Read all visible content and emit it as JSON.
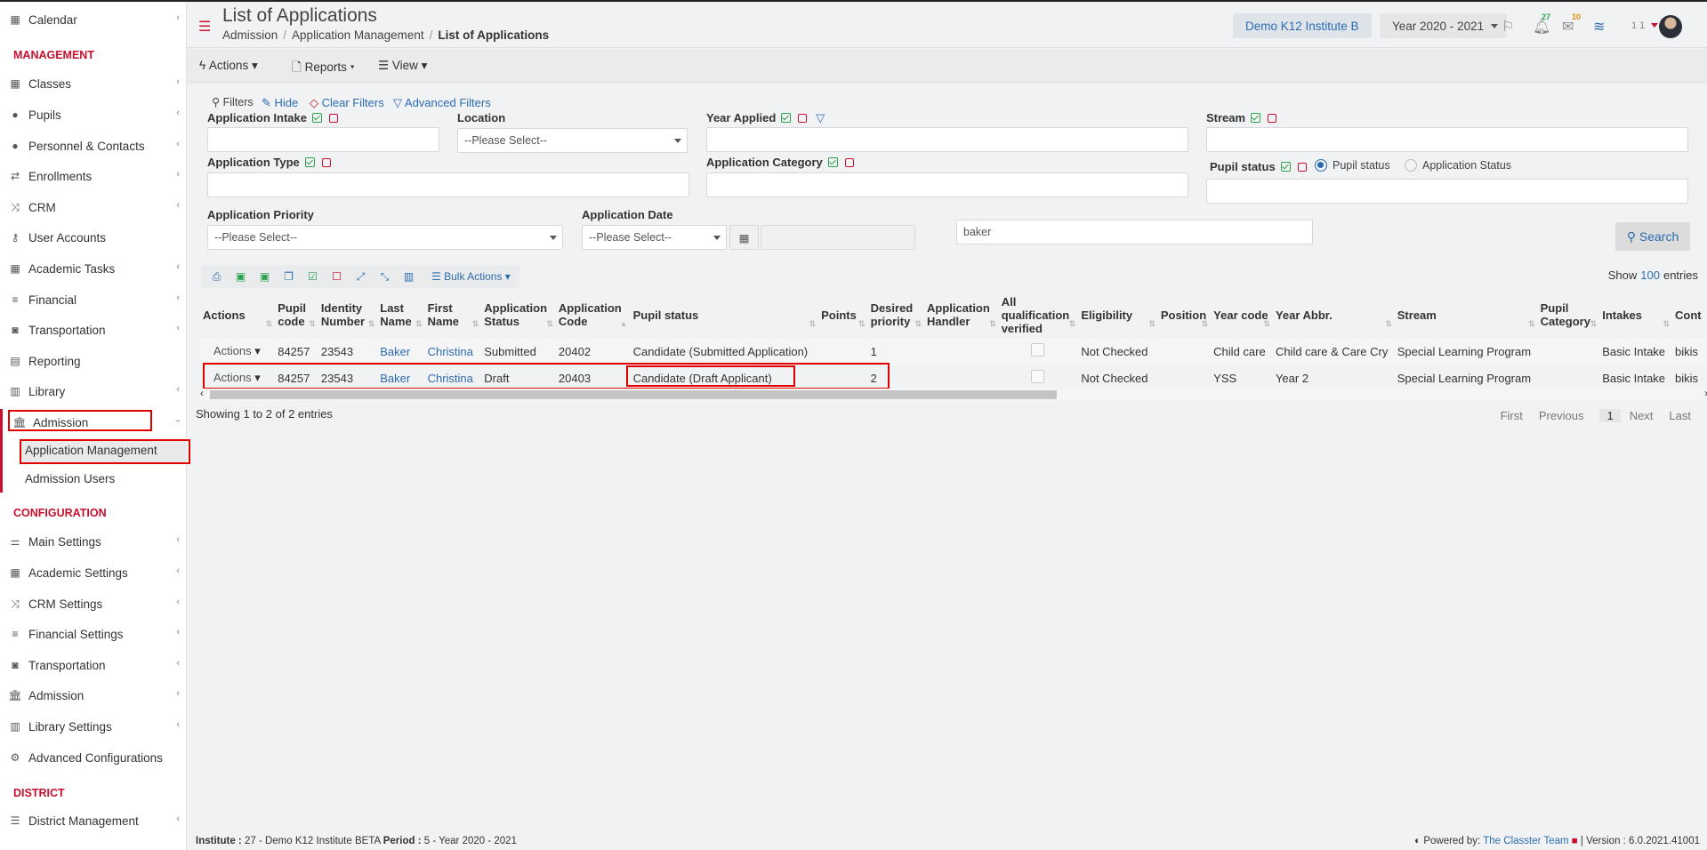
{
  "sidebar": {
    "calendar": "Calendar",
    "management_heading": "MANAGEMENT",
    "classes": "Classes",
    "pupils": "Pupils",
    "personnel": "Personnel & Contacts",
    "enrollments": "Enrollments",
    "crm": "CRM",
    "user_accounts": "User Accounts",
    "academic_tasks": "Academic Tasks",
    "financial": "Financial",
    "transportation": "Transportation",
    "reporting": "Reporting",
    "library": "Library",
    "admission": "Admission",
    "application_management": "Application Management",
    "admission_users": "Admission Users",
    "configuration_heading": "CONFIGURATION",
    "main_settings": "Main Settings",
    "academic_settings": "Academic Settings",
    "crm_settings": "CRM Settings",
    "financial_settings": "Financial Settings",
    "transportation2": "Transportation",
    "admission2": "Admission",
    "library_settings": "Library Settings",
    "advanced_configurations": "Advanced Configurations",
    "district_heading": "DISTRICT",
    "district_management": "District Management"
  },
  "header": {
    "title": "List of Applications",
    "crumb1": "Admission",
    "crumb2": "Application Management",
    "crumb3": "List of Applications",
    "institute": "Demo K12 Institute B",
    "year": "Year 2020 - 2021",
    "notif_count": "27",
    "mail_count": "10",
    "user_short": "1 1"
  },
  "toolbar": {
    "actions": "Actions",
    "reports": "Reports",
    "view": "View"
  },
  "filters": {
    "title": "Filters",
    "hide": "Hide",
    "clear": "Clear Filters",
    "advanced": "Advanced Filters",
    "application_intake": "Application Intake",
    "location": "Location",
    "location_value": "--Please Select--",
    "year_applied": "Year Applied",
    "stream": "Stream",
    "application_type": "Application Type",
    "application_category": "Application Category",
    "pupil_status": "Pupil status",
    "radio_pupil_status": "Pupil status",
    "radio_application_status": "Application Status",
    "application_priority": "Application Priority",
    "priority_value": "--Please Select--",
    "application_date": "Application Date",
    "date_value": "--Please Select--",
    "search_text": "baker",
    "search_button": "Search"
  },
  "table": {
    "bulk_actions": "Bulk Actions",
    "show": "Show",
    "show_count": "100",
    "entries": "entries",
    "headers": {
      "actions": "Actions",
      "pupil_code": "Pupil code",
      "identity_number": "Identity Number",
      "last_name": "Last Name",
      "first_name": "First Name",
      "application_status": "Application Status",
      "application_code": "Application Code",
      "pupil_status": "Pupil status",
      "points": "Points",
      "desired_priority": "Desired priority",
      "application_handler": "Application Handler",
      "all_qualification": "All qualification verified",
      "eligibility": "Eligibility",
      "position": "Position",
      "year_code": "Year code",
      "year_abbr": "Year Abbr.",
      "stream": "Stream",
      "pupil_category": "Pupil Category",
      "intakes": "Intakes",
      "cont": "Cont"
    },
    "rows": [
      {
        "actions": "Actions",
        "pupil_code": "84257",
        "identity_number": "23543",
        "last_name": "Baker",
        "first_name": "Christina",
        "application_status": "Submitted",
        "application_code": "20402",
        "pupil_status": "Candidate (Submitted Application)",
        "points": "",
        "desired_priority": "1",
        "eligibility": "Not Checked",
        "position": "",
        "year_code": "Child care",
        "year_abbr": "Child care & Care Cry",
        "stream": "Special Learning Program",
        "pupil_category": "",
        "intakes": "Basic Intake",
        "cont": "bikis"
      },
      {
        "actions": "Actions",
        "pupil_code": "84257",
        "identity_number": "23543",
        "last_name": "Baker",
        "first_name": "Christina",
        "application_status": "Draft",
        "application_code": "20403",
        "pupil_status": "Candidate (Draft Applicant)",
        "points": "",
        "desired_priority": "2",
        "eligibility": "Not Checked",
        "position": "",
        "year_code": "YSS",
        "year_abbr": "Year 2",
        "stream": "Special Learning Program",
        "pupil_category": "",
        "intakes": "Basic Intake",
        "cont": "bikis"
      }
    ],
    "showing": "Showing 1 to 2 of 2 entries",
    "pager": {
      "first": "First",
      "previous": "Previous",
      "page": "1",
      "next": "Next",
      "last": "Last"
    }
  },
  "footer": {
    "institute_label": "Institute :",
    "institute_value": "27 - Demo K12 Institute BETA",
    "period_label": "Period :",
    "period_value": "5 - Year 2020 - 2021",
    "powered_by": "Powered by:",
    "team": "The Classter Team",
    "version": "| Version : 6.0.2021.41001"
  },
  "colors": {
    "accent_red": "#c8102e",
    "link_blue": "#2b6cb0",
    "highlight_box": "#e00000"
  }
}
